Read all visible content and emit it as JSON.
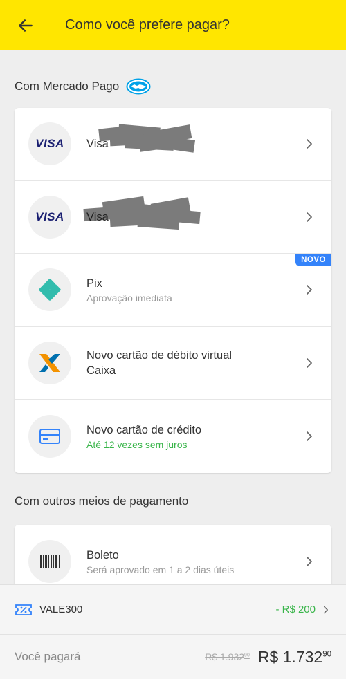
{
  "header": {
    "title": "Como você prefere pagar?"
  },
  "sections": {
    "mercado_pago": {
      "title": "Com Mercado Pago"
    },
    "others": {
      "title": "Com outros meios de pagamento"
    }
  },
  "cards": {
    "visa1": {
      "brand": "VISA",
      "title": "Visa"
    },
    "visa2": {
      "brand": "VISA",
      "title": "Visa"
    },
    "pix": {
      "title": "Pix",
      "subtitle": "Aprovação imediata",
      "badge": "NOVO"
    },
    "caixa": {
      "title_line1": "Novo cartão de débito virtual",
      "title_line2": "Caixa"
    },
    "credit": {
      "title": "Novo cartão de crédito",
      "subtitle": "Até 12 vezes sem juros"
    },
    "boleto": {
      "title": "Boleto",
      "subtitle": "Será aprovado em 1 a 2 dias úteis"
    }
  },
  "footer": {
    "coupon_code": "VALE300",
    "coupon_discount": "- R$ 200",
    "pay_label": "Você pagará",
    "old_price_int": "R$ 1.932",
    "old_price_cents": "90",
    "new_price_int": "R$ 1.732",
    "new_price_cents": "90"
  },
  "colors": {
    "header_bg": "#ffe600",
    "accent_blue": "#3483fa",
    "green": "#39b54a",
    "pix_teal": "#32bcad"
  }
}
